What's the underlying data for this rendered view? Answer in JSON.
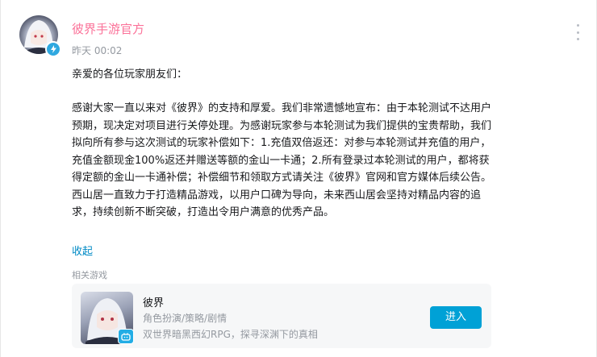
{
  "post": {
    "author": "彼界手游官方",
    "time": "昨天 00:02",
    "greeting": "亲爱的各位玩家朋友们：",
    "body": "感谢大家一直以来对《彼界》的支持和厚爱。我们非常遗憾地宣布：由于本轮测试不达用户预期，现决定对项目进行关停处理。为感谢玩家参与本轮测试为我们提供的宝贵帮助，我们拟向所有参与这次测试的玩家补偿如下：1.充值双倍返还：对参与本轮测试并充值的用户，充值金额现金100%返还并赠送等额的金山一卡通；2.所有登录过本轮测试的用户，都将获得定额的金山一卡通补偿；补偿细节和领取方式请关注《彼界》官网和官方媒体后续公告。西山居一直致力于打造精品游戏，以用户口碑为导向，未来西山居会坚持对精品内容的追求，持续创新不断突破，打造出令用户满意的优秀产品。",
    "collapse_label": "收起"
  },
  "related": {
    "label": "相关游戏",
    "game": {
      "name": "彼界",
      "tags": "角色扮演/策略/剧情",
      "description": "双世界暗黑西幻RPG，探寻深渊下的真相",
      "button_label": "进入"
    }
  },
  "colors": {
    "author": "#fb7299",
    "link": "#008ac5",
    "button": "#00a1d6",
    "badge": "#2fa8e0"
  },
  "icons": {
    "badge": "lightning-bolt-icon",
    "more": "more-vertical-icon",
    "cover_badge": "tv-icon"
  }
}
